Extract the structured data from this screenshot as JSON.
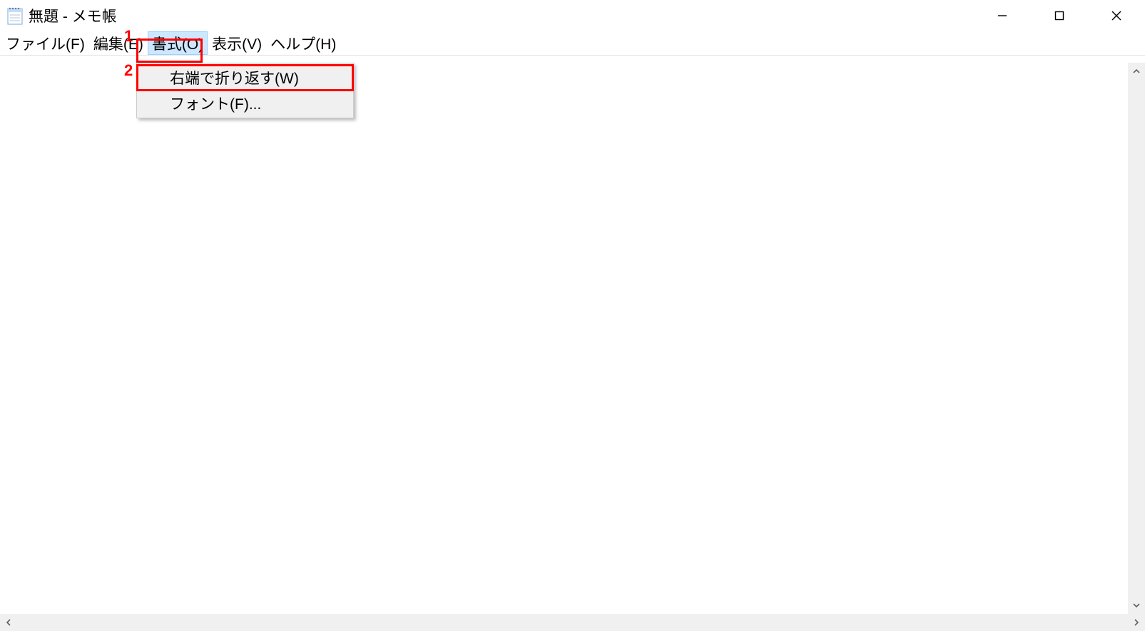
{
  "window": {
    "title": "無題 - メモ帳"
  },
  "menubar": {
    "file": "ファイル(F)",
    "edit": "編集(E)",
    "format": "書式(O)",
    "view": "表示(V)",
    "help": "ヘルプ(H)"
  },
  "format_menu": {
    "wrap": "右端で折り返す(W)",
    "font": "フォント(F)..."
  },
  "annotations": {
    "label1": "1",
    "label2": "2"
  }
}
